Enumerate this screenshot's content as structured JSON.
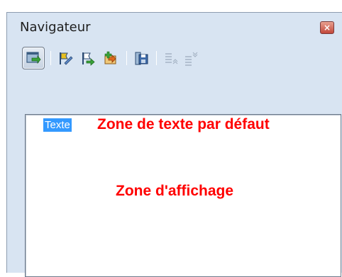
{
  "window": {
    "title": "Navigateur",
    "close_glyph": "×"
  },
  "toolbar": {
    "buttons": [
      {
        "icon": "navigator-toggle-icon",
        "state": "active"
      },
      {
        "icon": "edit-flag-icon",
        "state": "enabled"
      },
      {
        "icon": "forward-flag-icon",
        "state": "enabled"
      },
      {
        "icon": "insert-item-icon",
        "state": "enabled"
      },
      {
        "icon": "save-document-icon",
        "state": "enabled"
      },
      {
        "icon": "move-up-icon",
        "state": "disabled"
      },
      {
        "icon": "move-down-icon",
        "state": "disabled"
      }
    ]
  },
  "tree": {
    "items": [
      {
        "label": "Texte",
        "selected": true
      }
    ]
  },
  "annotations": {
    "default_zone": "Zone de texte par défaut",
    "display_zone": "Zone d'affichage",
    "color": "#ff0000"
  },
  "colors": {
    "selection": "#3399ff",
    "panel": "#d8e4f2"
  }
}
